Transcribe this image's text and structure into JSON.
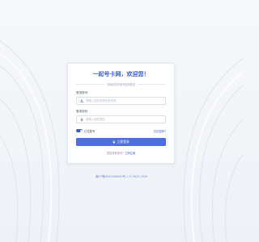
{
  "login": {
    "title": "一起号卡网，欢迎您！",
    "subtitle": "请使用您的账号密码登录",
    "username_label": "登录账号",
    "username_placeholder": "请输入您的登录手机号码",
    "password_label": "登录密码",
    "password_placeholder": "请输入您的密码",
    "remember_label": "记住账号",
    "remember_checked": true,
    "forgot_label": "忘记密码?",
    "submit_label": "立即登录",
    "register_prefix": "若还未有账号？",
    "register_link": "立即注册"
  },
  "footer": {
    "icp": "湘ICP备2022000025号-1 © 2020-2025"
  },
  "icons": {
    "username": "user-icon",
    "password": "lock-icon",
    "submit": "lock-icon"
  },
  "colors": {
    "accent": "#3a5fd1",
    "button": "#4d6fe0",
    "background": "#f2f4f8"
  }
}
